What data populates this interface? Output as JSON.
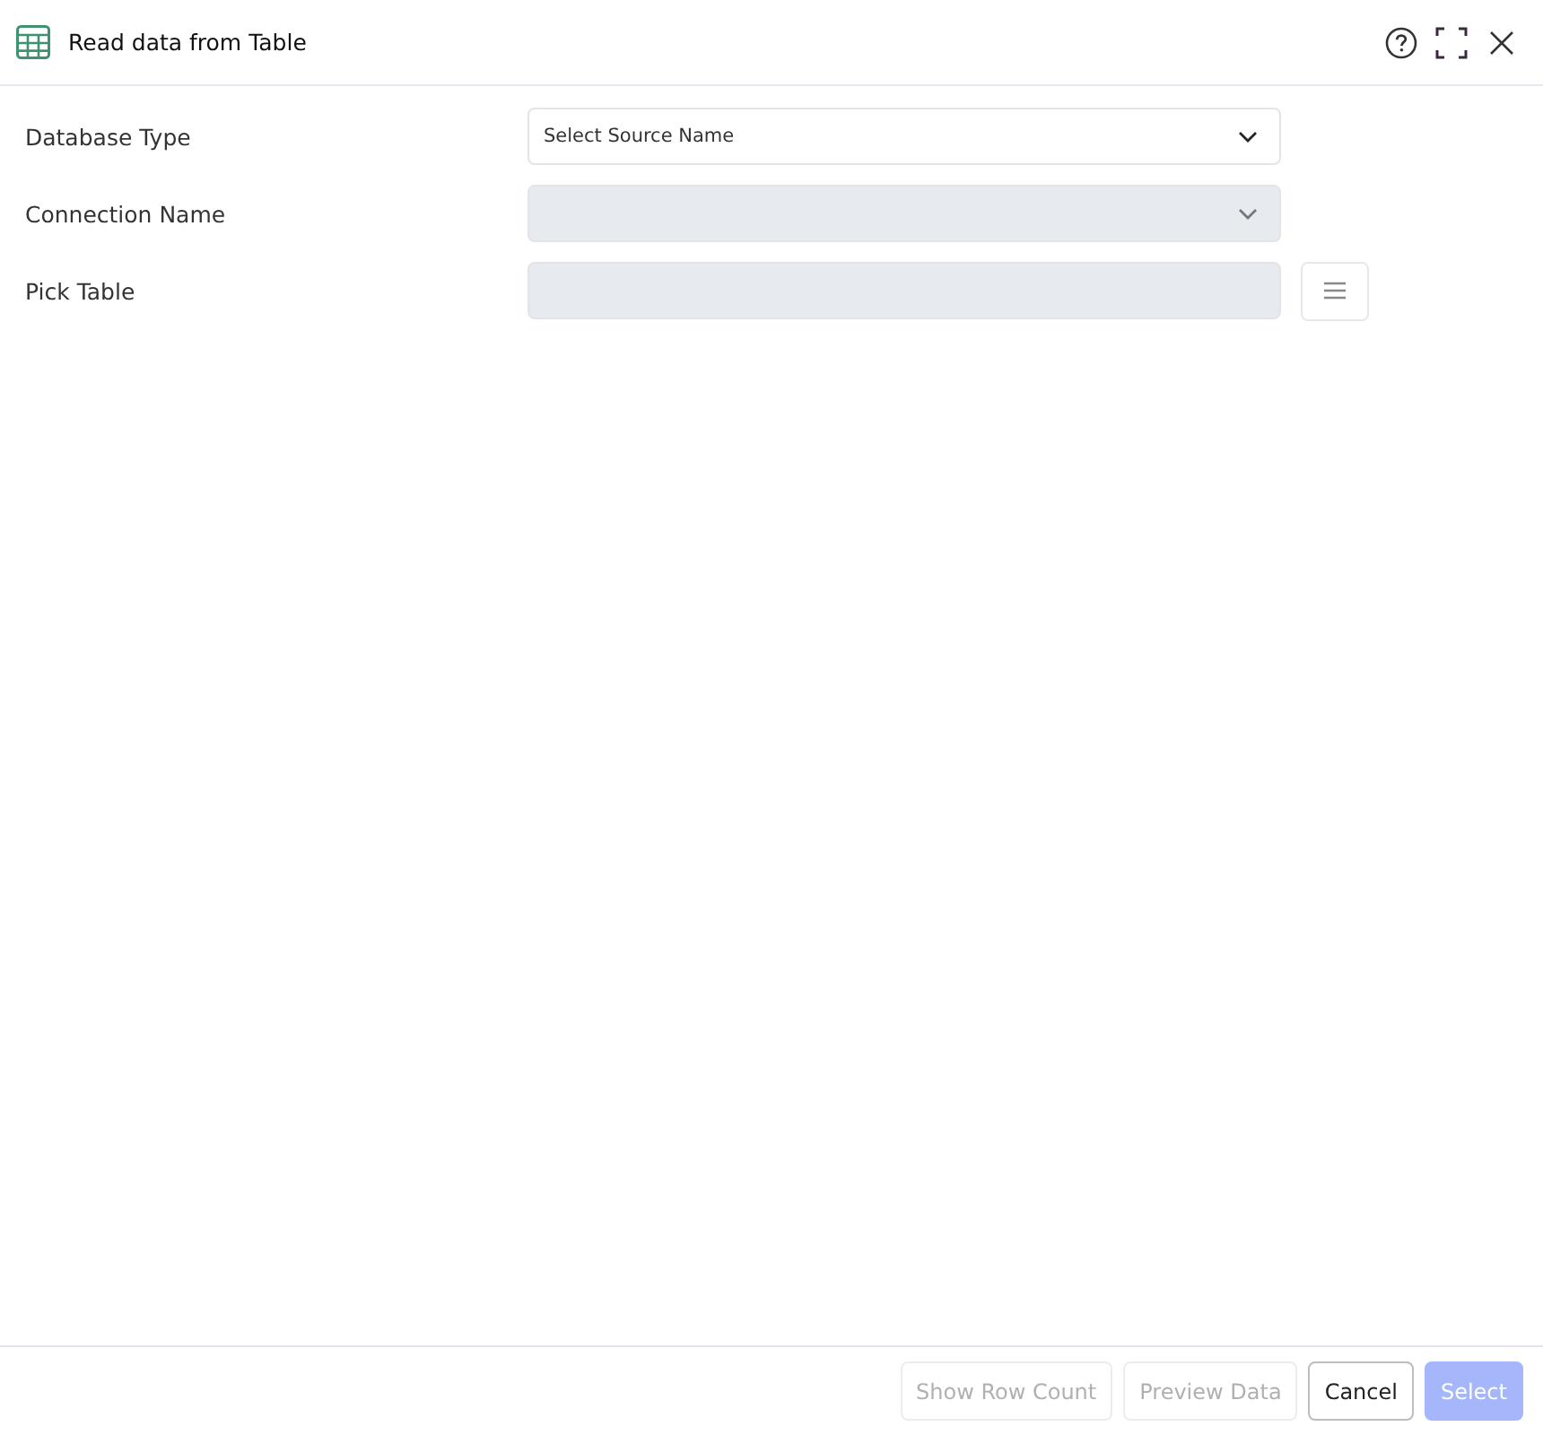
{
  "window": {
    "title": "Read data from Table"
  },
  "form": {
    "fields": [
      {
        "label": "Database Type",
        "kind": "select",
        "placeholder": "Select Source Name",
        "disabled": false
      },
      {
        "label": "Connection Name",
        "kind": "select",
        "disabled": true
      },
      {
        "label": "Pick Table",
        "kind": "picker",
        "disabled": true
      }
    ]
  },
  "footer": {
    "buttons": [
      {
        "label": "Show Row Count",
        "kind": "secondary",
        "disabled": true
      },
      {
        "label": "Preview Data",
        "kind": "secondary",
        "disabled": true
      },
      {
        "label": "Cancel",
        "kind": "secondary",
        "disabled": false
      },
      {
        "label": "Select",
        "kind": "primary",
        "disabled": true
      }
    ]
  }
}
